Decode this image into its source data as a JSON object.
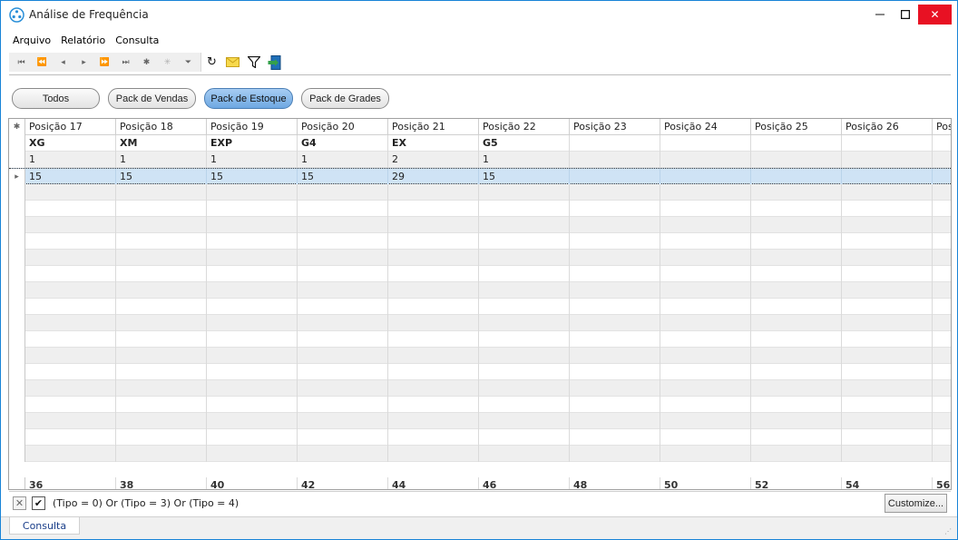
{
  "window": {
    "title": "Análise de Frequência",
    "close_glyph": "✕",
    "min_glyph": "—",
    "max_glyph": "☐"
  },
  "menu": {
    "items": [
      {
        "label": "Arquivo"
      },
      {
        "label": "Relatório"
      },
      {
        "label": "Consulta"
      }
    ]
  },
  "toolbar": {
    "nav_icons": [
      "first-record-icon",
      "prev-page-icon",
      "prev-record-icon",
      "next-record-icon",
      "next-page-icon",
      "last-record-icon",
      "insert-record-icon",
      "delete-record-icon",
      "filter-record-icon"
    ],
    "nav_glyphs": [
      "⏮",
      "⏪",
      "◂",
      "▸",
      "⏩",
      "⏭",
      "✱",
      "✳",
      "⏷"
    ],
    "refresh_glyph": "↻",
    "email_glyph": "✉",
    "filter_glyph": "⛉",
    "exit_glyph": "⇥"
  },
  "filters": {
    "buttons": [
      {
        "label": "Todos",
        "active": false
      },
      {
        "label": "Pack de Vendas",
        "active": false
      },
      {
        "label": "Pack de Estoque",
        "active": true
      },
      {
        "label": "Pack de Grades",
        "active": false
      }
    ]
  },
  "grid": {
    "columns": [
      "Posição 17",
      "Posição 18",
      "Posição 19",
      "Posição 20",
      "Posição 21",
      "Posição 22",
      "Posição 23",
      "Posição 24",
      "Posição 25",
      "Posição 26",
      "Posi"
    ],
    "rows": [
      [
        "XG",
        "XM",
        "EXP",
        "G4",
        "EX",
        "G5",
        "",
        "",
        "",
        "",
        ""
      ],
      [
        "1",
        "1",
        "1",
        "1",
        "2",
        "1",
        "",
        "",
        "",
        "",
        ""
      ],
      [
        "15",
        "15",
        "15",
        "15",
        "29",
        "15",
        "",
        "",
        "",
        "",
        ""
      ]
    ],
    "footer": [
      "36",
      "38",
      "40",
      "42",
      "44",
      "46",
      "48",
      "50",
      "52",
      "54",
      "56"
    ],
    "selected_row_index": 2,
    "header_indicator_glyph": "✱",
    "row_indicator_glyph": "▸"
  },
  "filter_panel": {
    "expression": "(Tipo = 0) Or (Tipo = 3) Or (Tipo = 4)",
    "enabled": true,
    "close_glyph": "✕",
    "check_glyph": "✔",
    "customize_label": "Customize..."
  },
  "tabs": [
    {
      "label": "Consulta"
    }
  ],
  "colors": {
    "accent_border": "#1883d7",
    "close_button": "#e81123",
    "selected_row": "#cfe3f5",
    "active_filter": "#6ea8e2"
  }
}
